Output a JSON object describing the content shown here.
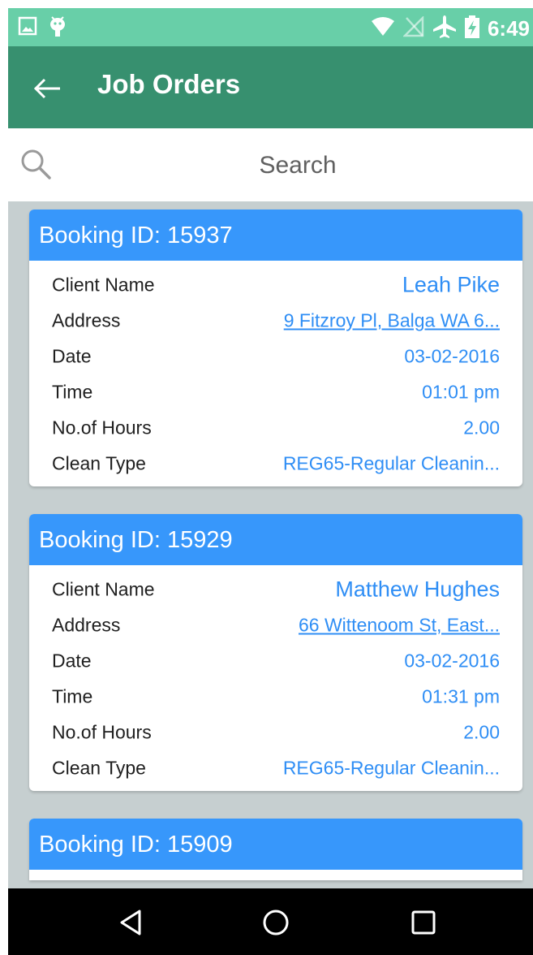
{
  "status_bar": {
    "time": "6:49",
    "icons": [
      "image-icon",
      "android-icon",
      "wifi-icon",
      "no-signal-icon",
      "airplane-icon",
      "battery-charging-icon"
    ]
  },
  "app_bar": {
    "title": "Job Orders",
    "back_icon": "arrow-left-icon"
  },
  "search": {
    "placeholder": "Search",
    "value": ""
  },
  "labels": {
    "client_name": "Client Name",
    "address": "Address",
    "date": "Date",
    "time": "Time",
    "hours": "No.of Hours",
    "clean_type": "Clean Type"
  },
  "bookings": [
    {
      "header": "Booking ID: 15937",
      "client_name": "Leah  Pike",
      "address": "9 Fitzroy Pl, Balga WA 6...",
      "date": "03-02-2016",
      "time": "01:01 pm",
      "hours": "2.00",
      "clean_type": "REG65-Regular Cleanin..."
    },
    {
      "header": "Booking ID: 15929",
      "client_name": "Matthew  Hughes",
      "address": "66 Wittenoom St, East...",
      "date": "03-02-2016",
      "time": "01:31 pm",
      "hours": "2.00",
      "clean_type": "REG65-Regular Cleanin..."
    },
    {
      "header": "Booking ID: 15909"
    }
  ],
  "nav_bar": {
    "icons": [
      "back-triangle-icon",
      "home-circle-icon",
      "recents-square-icon"
    ]
  },
  "colors": {
    "status_bar": "#68cfa8",
    "app_bar": "#37906f",
    "card_header": "#3797fb",
    "value_text": "#2f8ef5",
    "background": "#c6cfd0"
  }
}
